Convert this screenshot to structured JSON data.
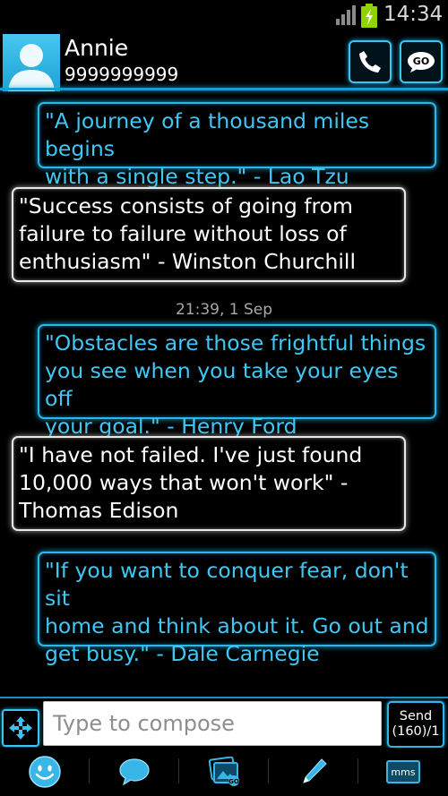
{
  "status_bar": {
    "time": "14:34"
  },
  "contact": {
    "name": "Annie",
    "number": "9999999999"
  },
  "messages": [
    {
      "direction": "outgoing",
      "text": "\"A journey of a thousand miles begins\nwith a single step.\" - Lao Tzu"
    },
    {
      "direction": "incoming",
      "text": "\"Success consists of going from\nfailure to failure without loss of\nenthusiasm\" - Winston Churchill"
    },
    {
      "direction": "outgoing",
      "text": "\"Obstacles are those frightful things\nyou see when you take your eyes off\nyour goal.\" - Henry Ford"
    },
    {
      "direction": "incoming",
      "text": "\"I have not failed. I've just found\n10,000 ways that won't work\" -\nThomas Edison"
    },
    {
      "direction": "outgoing",
      "text": "\"If you want to conquer fear, don't sit\nhome and think about it. Go out and\nget busy.\" - Dale Carnegie"
    }
  ],
  "timestamp": "21:39, 1 Sep",
  "compose": {
    "placeholder": "Type to compose",
    "send_label": "Send",
    "counter": "(160)/1"
  },
  "toolbar": {
    "mms_label": "mms"
  },
  "icons": {
    "signal": "signal-icon",
    "battery": "battery-charging-icon",
    "call": "phone-icon",
    "go": "go-icon",
    "expand": "expand-arrows-icon",
    "smiley": "smiley-icon",
    "chat": "speech-bubble-icon",
    "attach": "attach-picture-icon",
    "edit": "pencil-icon",
    "mms": "mms-icon"
  },
  "colors": {
    "accent": "#2fb6e6",
    "outgoing_text": "#3ec8f5",
    "incoming_border": "#e8e8e8"
  }
}
